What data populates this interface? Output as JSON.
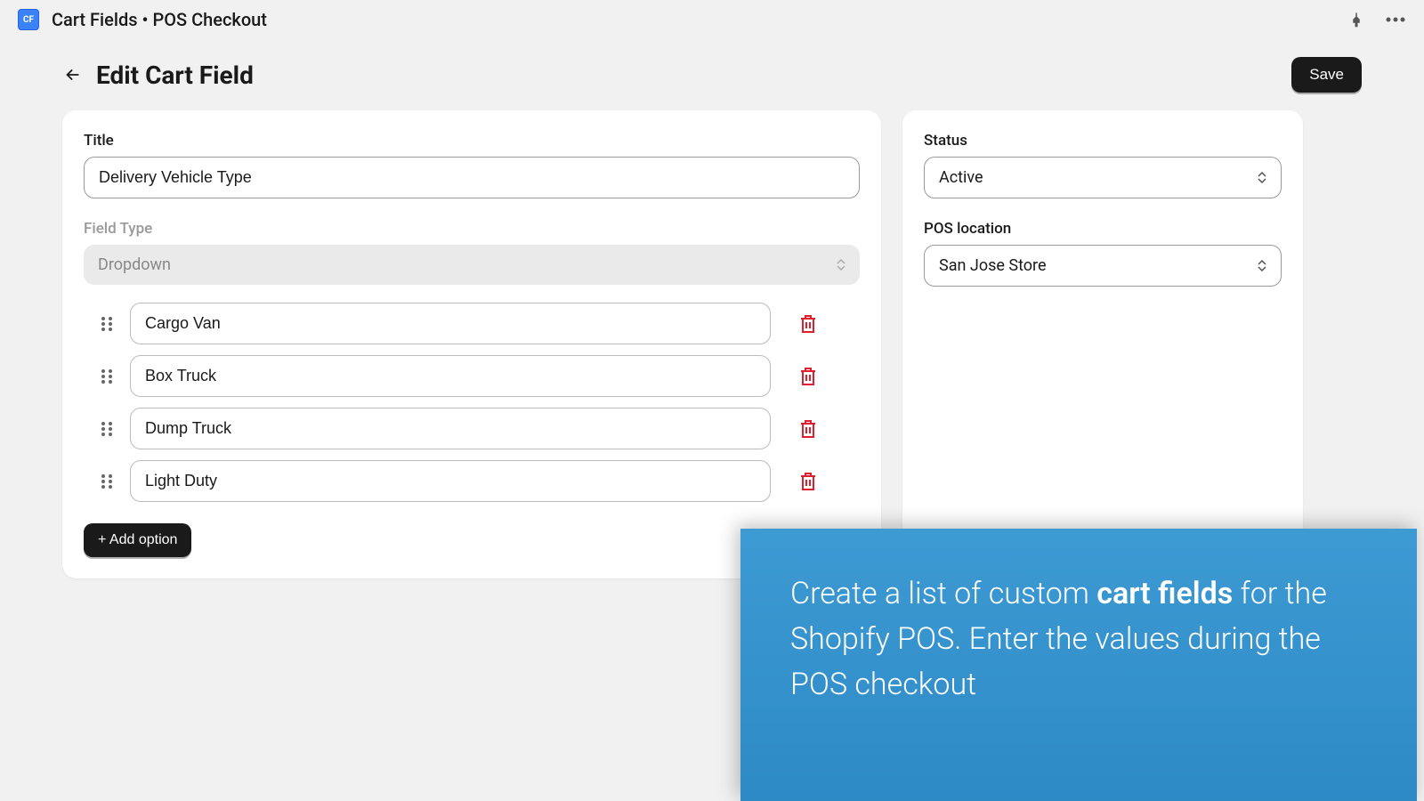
{
  "header": {
    "app_title": "Cart Fields • POS Checkout"
  },
  "page": {
    "title": "Edit Cart Field",
    "save_label": "Save"
  },
  "main": {
    "title_label": "Title",
    "title_value": "Delivery Vehicle Type",
    "field_type_label": "Field Type",
    "field_type_value": "Dropdown",
    "options": [
      "Cargo Van",
      "Box Truck",
      "Dump Truck",
      "Light Duty"
    ],
    "add_option_label": "+ Add option"
  },
  "sidebar": {
    "status_label": "Status",
    "status_value": "Active",
    "location_label": "POS location",
    "location_value": "San Jose Store"
  },
  "overlay": {
    "text_before": "Create a list of custom ",
    "text_bold": "cart fields",
    "text_after": " for the Shopify POS. Enter the values during the POS checkout"
  },
  "hidden": {
    "delete": "Delete",
    "save": "Save"
  }
}
